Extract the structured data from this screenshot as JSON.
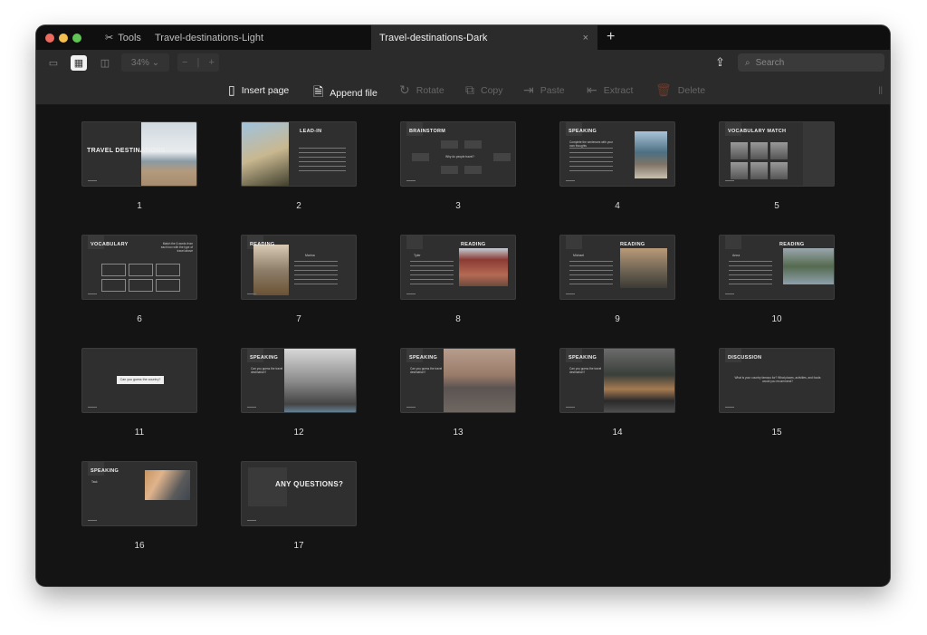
{
  "window": {
    "traffic_lights": {
      "close": "#ec6a5e",
      "minimize": "#f4bf4f",
      "zoom": "#61c554"
    }
  },
  "tabs": {
    "tools_label": "Tools",
    "items": [
      {
        "label": "Travel-destinations-Light",
        "active": false
      },
      {
        "label": "Travel-destinations-Dark",
        "active": true
      }
    ],
    "close": "×",
    "new_tab": "+"
  },
  "view_toolbar": {
    "zoom_value": "34%",
    "zoom_minus": "−",
    "zoom_plus": "+",
    "search_placeholder": "Search"
  },
  "actions": [
    {
      "label": "Insert page",
      "icon": "insert-page-icon",
      "enabled": true
    },
    {
      "label": "Append file",
      "icon": "append-pdf-icon",
      "enabled": true
    },
    {
      "label": "Rotate",
      "icon": "rotate-icon",
      "enabled": false
    },
    {
      "label": "Copy",
      "icon": "copy-icon",
      "enabled": false
    },
    {
      "label": "Paste",
      "icon": "paste-icon",
      "enabled": false
    },
    {
      "label": "Extract",
      "icon": "extract-icon",
      "enabled": false
    },
    {
      "label": "Delete",
      "icon": "trash-icon",
      "enabled": false
    }
  ],
  "pages": [
    {
      "number": "1",
      "title": "TRAVEL DESTINATIONS",
      "text": ""
    },
    {
      "number": "2",
      "title": "LEAD-IN",
      "text": ""
    },
    {
      "number": "3",
      "title": "BRAINSTORM",
      "text": "Why do people travel?"
    },
    {
      "number": "4",
      "title": "SPEAKING",
      "text": "Complete the sentences with your own thoughts"
    },
    {
      "number": "5",
      "title": "VOCABULARY MATCH",
      "text": ""
    },
    {
      "number": "6",
      "title": "VOCABULARY",
      "text": "Match the 6 words from each box with the type of travel above"
    },
    {
      "number": "7",
      "title": "READING",
      "text": "Marina"
    },
    {
      "number": "8",
      "title": "READING",
      "text": "Tyler"
    },
    {
      "number": "9",
      "title": "READING",
      "text": "Michael"
    },
    {
      "number": "10",
      "title": "READING",
      "text": "Anna"
    },
    {
      "number": "11",
      "title": "",
      "text": "Can you guess the country?"
    },
    {
      "number": "12",
      "title": "SPEAKING",
      "text": "Can you guess the travel destination?"
    },
    {
      "number": "13",
      "title": "SPEAKING",
      "text": "Can you guess the travel destination?"
    },
    {
      "number": "14",
      "title": "SPEAKING",
      "text": "Can you guess the travel destination?"
    },
    {
      "number": "15",
      "title": "DISCUSSION",
      "text": "What is your country famous for? What places, activities, and foods would you recommend?"
    },
    {
      "number": "16",
      "title": "SPEAKING",
      "text": "Task"
    },
    {
      "number": "17",
      "title": "ANY QUESTIONS?",
      "text": ""
    }
  ]
}
